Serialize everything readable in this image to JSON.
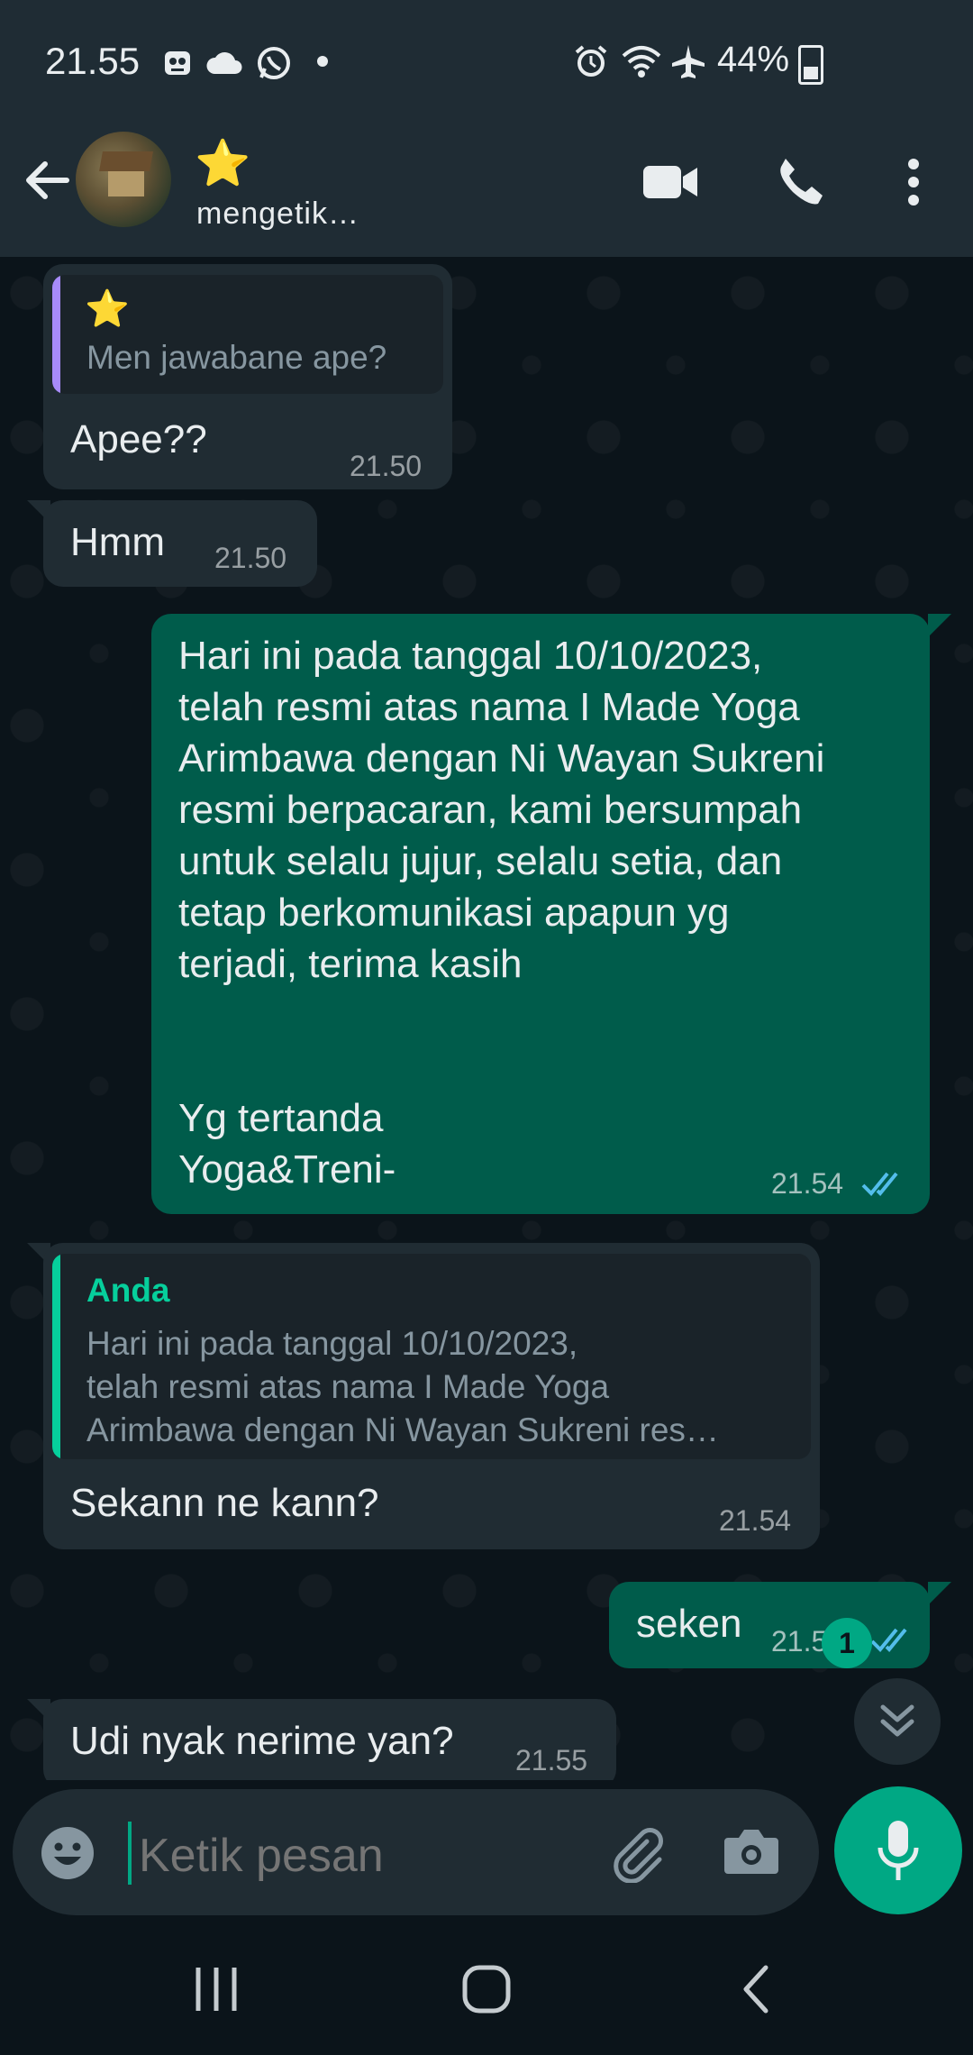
{
  "status_bar": {
    "time": "21.55",
    "left_icons": [
      "notification-icon",
      "cloud-icon",
      "whatsapp-icon",
      "dot-icon"
    ],
    "right_icons": [
      "alarm-icon",
      "wifi-icon",
      "airplane-icon"
    ],
    "battery": "44%"
  },
  "header": {
    "contact_name": "⭐",
    "status": "mengetik…"
  },
  "messages": [
    {
      "direction": "in",
      "quote_sender": "⭐",
      "quote_text": "Men jawabane ape?",
      "text": "Apee??",
      "time": "21.50"
    },
    {
      "direction": "in",
      "text": "Hmm",
      "time": "21.50"
    },
    {
      "direction": "out",
      "text": "Hari ini pada tanggal 10/10/2023,\ntelah resmi atas nama I Made Yoga\nArimbawa dengan Ni Wayan Sukreni\nresmi berpacaran, kami bersumpah\nuntuk selalu jujur, selalu setia, dan\ntetap berkomunikasi apapun yg\nterjadi, terima kasih\n\n\nYg tertanda\nYoga&Treni-",
      "time": "21.54",
      "status": "read"
    },
    {
      "direction": "in",
      "quote_sender": "Anda",
      "quote_text": "Hari ini pada tanggal 10/10/2023,\ntelah resmi atas nama I Made Yoga\nArimbawa dengan Ni Wayan Sukreni res…",
      "text": "Sekann ne kann?",
      "time": "21.54"
    },
    {
      "direction": "out",
      "text": "seken",
      "time": "21.5",
      "status": "read"
    },
    {
      "direction": "in",
      "text": "Udi nyak nerime yan?",
      "time": "21.55"
    }
  ],
  "unread_count": "1",
  "input": {
    "placeholder": "Ketik pesan"
  },
  "colors": {
    "accent": "#00a884",
    "outgoing": "#005c4b",
    "incoming": "#202c33",
    "background": "#0b141a",
    "read_ticks": "#53bdeb"
  }
}
